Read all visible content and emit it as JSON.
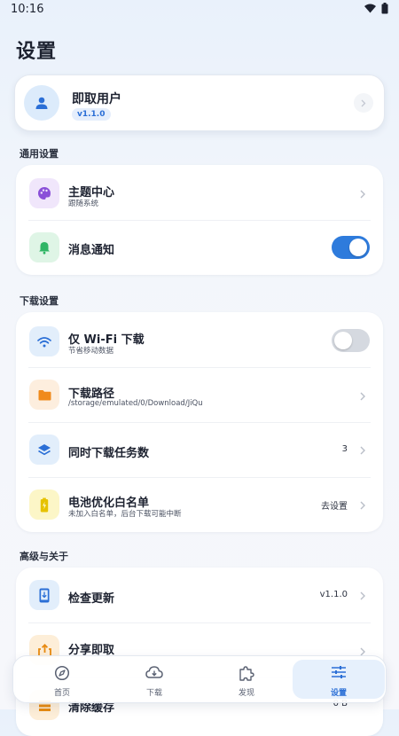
{
  "status_bar": {
    "time": "10:16"
  },
  "page": {
    "title": "设置"
  },
  "profile": {
    "name": "即取用户",
    "version": "v1.1.0"
  },
  "sections": {
    "general": "通用设置",
    "download": "下载设置",
    "advanced": "高级与关于"
  },
  "general_rows": {
    "theme": {
      "title": "主题中心",
      "subtitle": "跟随系统"
    },
    "notify": {
      "title": "消息通知",
      "toggle_on": true
    }
  },
  "download_rows": {
    "wifi": {
      "title": "仅 Wi-Fi 下载",
      "subtitle": "节省移动数据",
      "toggle_on": false
    },
    "path": {
      "title": "下载路径",
      "subtitle": "/storage/emulated/0/Download/JiQu"
    },
    "concurrent": {
      "title": "同时下载任务数",
      "value": "3"
    },
    "battery": {
      "title": "电池优化白名单",
      "subtitle": "未加入白名单，后台下载可能中断",
      "value": "去设置"
    }
  },
  "advanced_rows": {
    "update": {
      "title": "检查更新",
      "value": "v1.1.0"
    },
    "share": {
      "title": "分享即取"
    },
    "cache": {
      "title": "清除缓存",
      "value": "0 B"
    }
  },
  "nav": {
    "home": "首页",
    "download": "下载",
    "discover": "发现",
    "settings": "设置"
  },
  "colors": {
    "accent": "#2b6fd6",
    "toggle_on": "#2e7bdc",
    "toggle_off": "#d5d9e0"
  }
}
